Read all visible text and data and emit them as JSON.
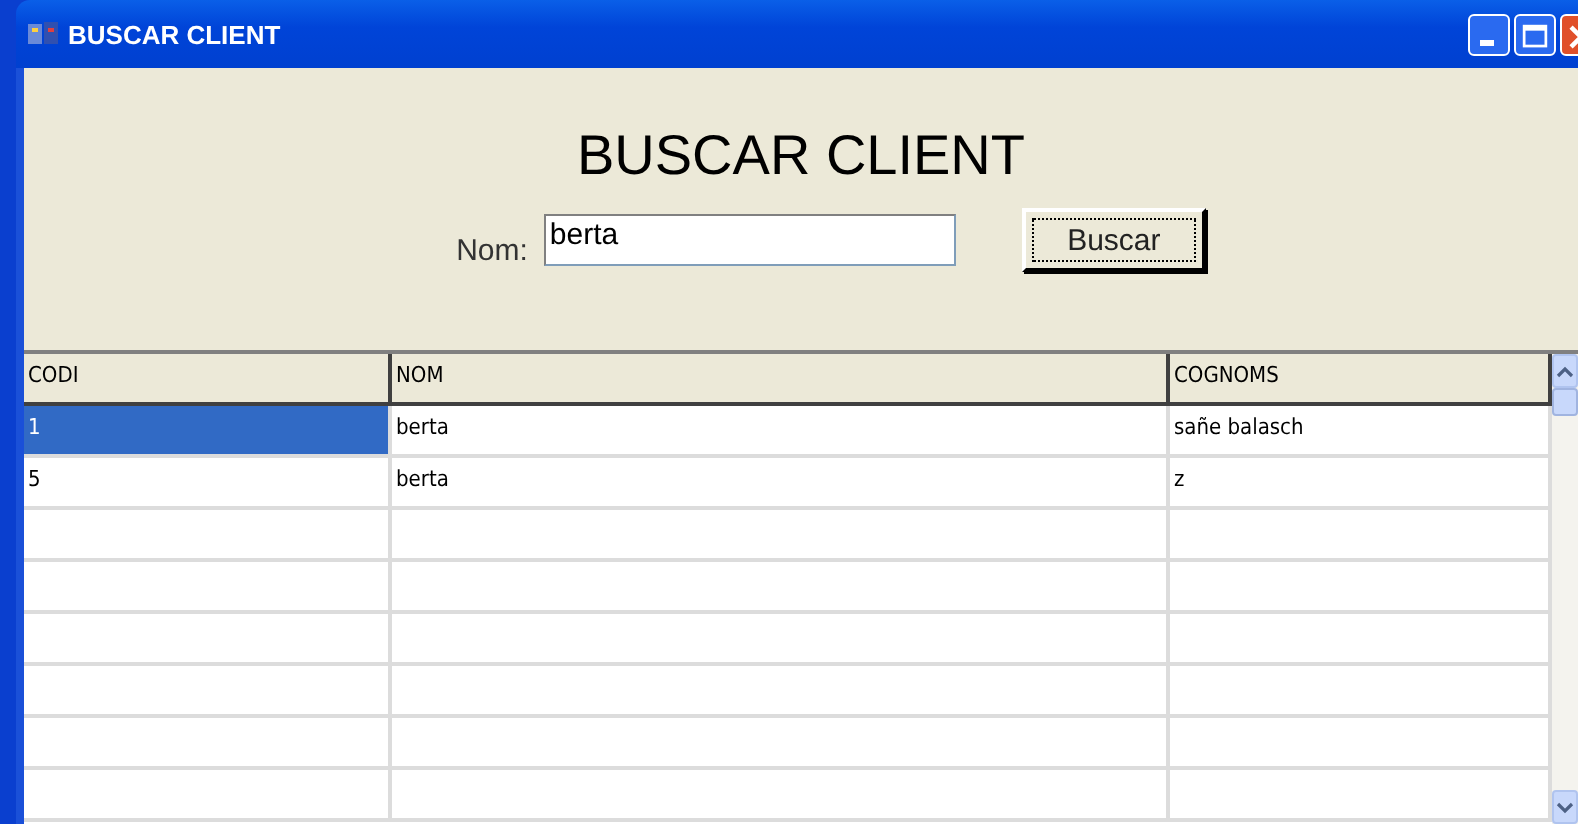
{
  "window": {
    "title": "BUSCAR CLIENT"
  },
  "heading": "BUSCAR CLIENT",
  "search": {
    "label": "Nom:",
    "value": "berta",
    "button": "Buscar"
  },
  "table": {
    "columns": [
      "CODI",
      "NOM",
      "COGNOMS"
    ],
    "rows": [
      {
        "cells": [
          "1",
          "berta",
          "sañe balasch"
        ],
        "selected": true
      },
      {
        "cells": [
          "5",
          "berta",
          "z"
        ],
        "selected": false
      }
    ]
  }
}
